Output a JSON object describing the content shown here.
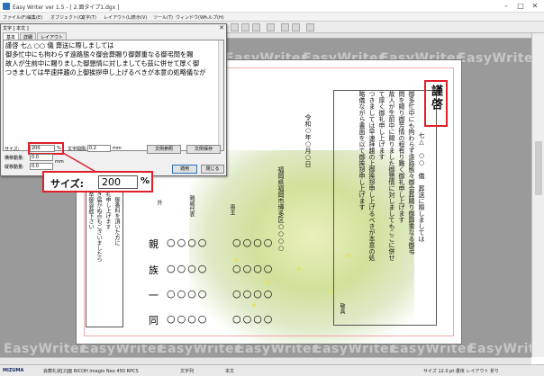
{
  "window": {
    "title": "Easy Writer ver 1.5 - [ 2.面タイプ1.dgx ]",
    "min": "–",
    "max": "□",
    "close": "✕"
  },
  "menu": [
    "ファイル(F)",
    "編集(E)",
    "オブジェクト(O)",
    "文字(T)",
    "レイアウト(L)",
    "表示(V)",
    "ツール(T)",
    "ウィンドウ(W)",
    "ヘルプ(H)"
  ],
  "watermark": "EasyWriter",
  "dialog": {
    "title": "文字 [ 本文 ]",
    "close": "✕",
    "tabs": [
      "基本",
      "詳細",
      "レイアウト"
    ],
    "lines": [
      "謹啓 七△ ○○ 儀 葬送に際しましては",
      "御多忙中にも拘わらず遠路態々御会葬賜り御鄭重なる御弔問を賜",
      "故人が生前中に賜りました御懇情に対しましても茲に併せて厚く御",
      "つきましては早速拝趨の上御挨拶申し上げるべきが本意の処略儀なが"
    ],
    "size_label": "サイズ:",
    "size_value": "200",
    "size_unit": "%",
    "pitch_label": "文字間隔:",
    "pitch_value": "0.2",
    "pitch_unit": "mm",
    "hspace_label": "横移動量:",
    "hspace_value": "0.0",
    "vspace_label": "縦移動量:",
    "vspace_value": "0.0",
    "offset_unit": "mm",
    "ref_button": "文例参照",
    "save_button": "文例保存",
    "apply_button": "適用",
    "close_button": "閉じる"
  },
  "callout": {
    "label": "サイズ:",
    "value": "200",
    "unit": "%"
  },
  "document": {
    "heading": "謹啓",
    "body_lines": [
      "七△　○○　儀　葬送に際しましては",
      "御多忙中にも拘わらず遠路態々御会葬賜り御鄭重なる御弔",
      "問を賜り御芳情の程有り難く御礼申し上げます",
      "故人が生前中に賜りました御懇情に対しましてもここに併せ",
      "て厚く御礼申し上げます",
      "つきましては早速拝趨の上御挨拶申し上げるべきが本意の処",
      "略儀ながら書面を以て御挨拶申し上げます",
      "敬具"
    ],
    "date": "令和○年○月○日",
    "address": "福岡県福岡市博多区○○○○",
    "relations": [
      "外",
      "親戚代表",
      "喪主"
    ],
    "relative": "親",
    "family": "族",
    "group_one": "一",
    "group_same": "同",
    "circles": "○○○○",
    "note_lines": [
      "尚　御香料を頂いた方に",
      "御礼申し上げます",
      "行き届かぬ点もございましたら",
      "何卒御容赦下さい"
    ]
  },
  "status": {
    "brand": "MIZUMA",
    "printer": "会葬礼状[2]面 RICOH imagio Neo 450 RPCS",
    "mode": "文字列",
    "object": "本文",
    "font_info": "サイズ 12.0 pt 書体 レイアウト 折り",
    "ready": ""
  },
  "colors": {
    "accent_red": "#e0202a",
    "pink_border": "#f2a9a9",
    "workspace": "#9a9a9a"
  }
}
